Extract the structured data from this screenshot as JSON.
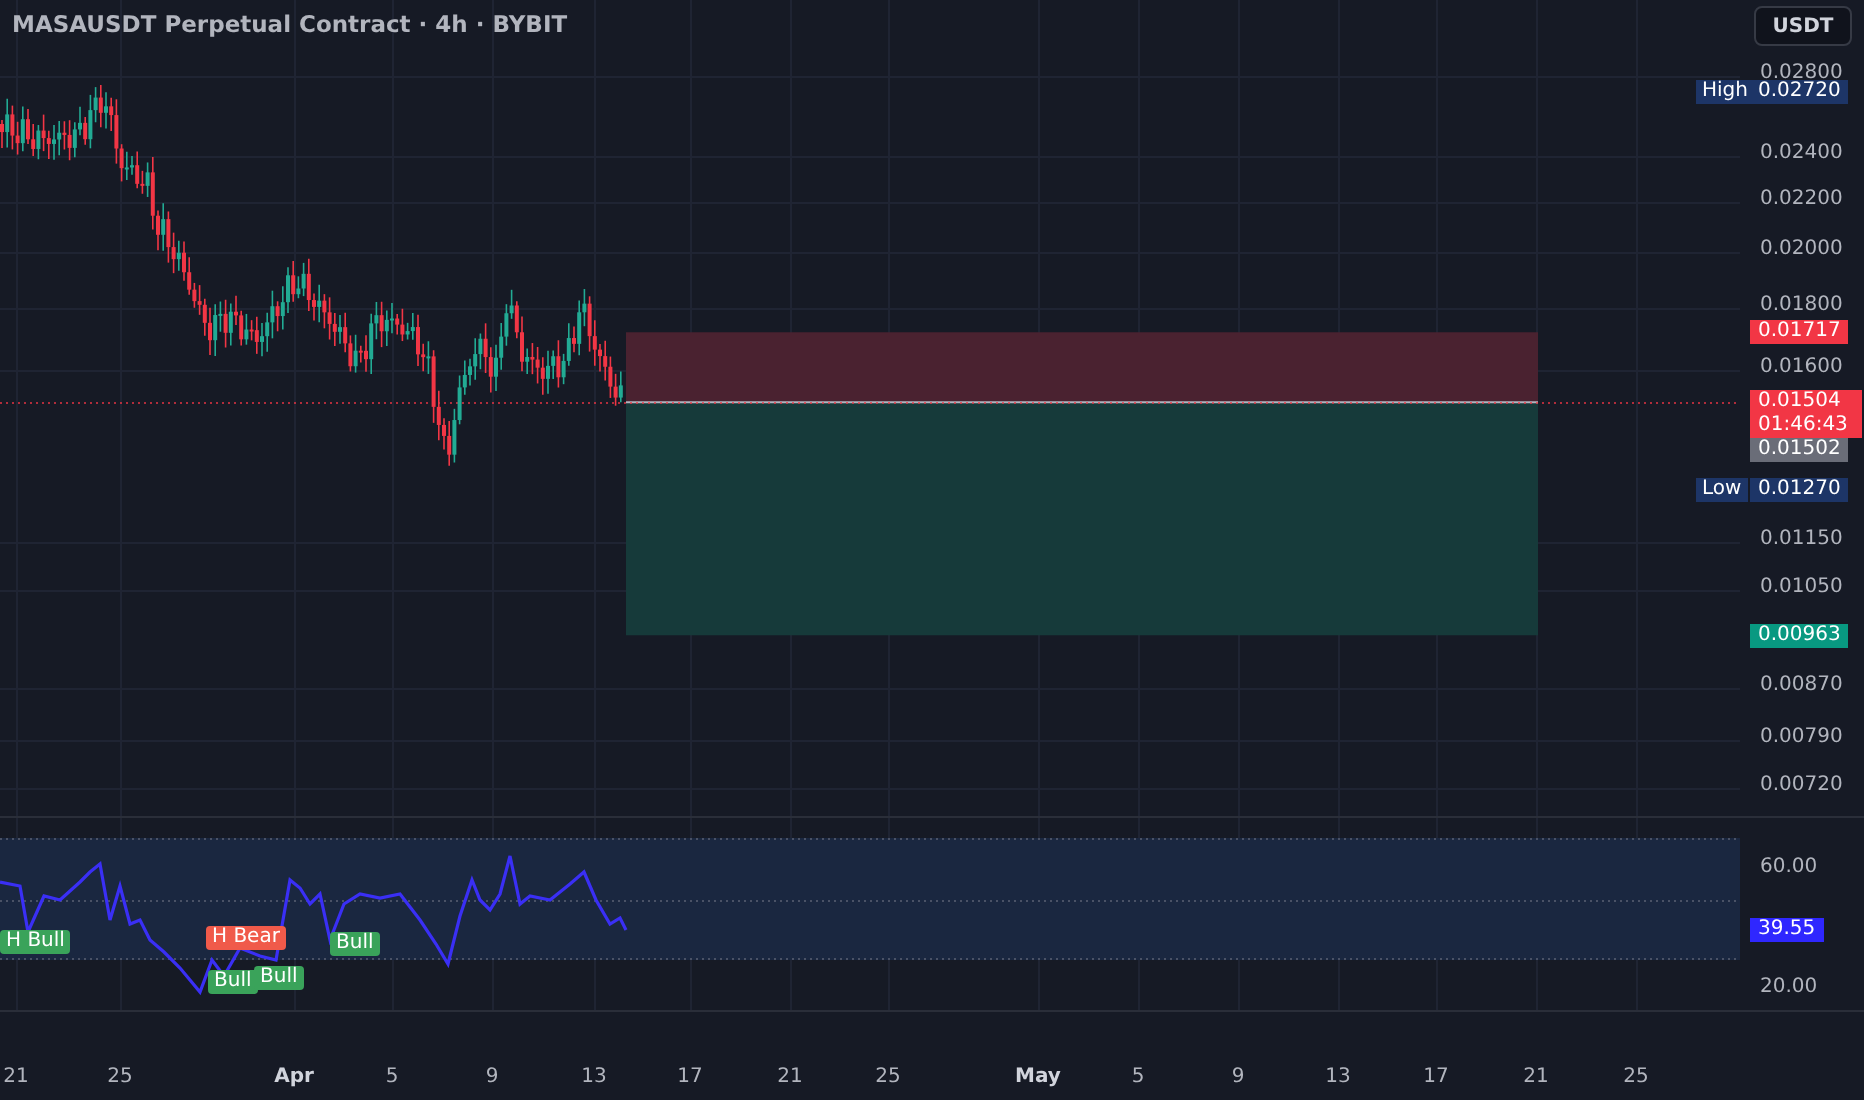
{
  "header": {
    "title": "MASAUSDT Perpetual Contract · 4h · BYBIT",
    "currency": "USDT"
  },
  "price_axis": {
    "ticks": [
      "0.02800",
      "0.02400",
      "0.02200",
      "0.02000",
      "0.01800",
      "0.01600",
      "0.01150",
      "0.01050",
      "0.00870",
      "0.00790",
      "0.00720"
    ],
    "markers": [
      {
        "kind": "high",
        "label": "High",
        "value": "0.02720"
      },
      {
        "kind": "stop",
        "value": "0.01717"
      },
      {
        "kind": "last",
        "value": "0.01504",
        "countdown": "01:46:43"
      },
      {
        "kind": "entry",
        "value": "0.01502"
      },
      {
        "kind": "low",
        "label": "Low",
        "value": "0.01270"
      },
      {
        "kind": "target",
        "value": "0.00963"
      }
    ]
  },
  "oscillator": {
    "ticks": [
      "60.00",
      "20.00"
    ],
    "value": "39.55",
    "signals": [
      {
        "kind": "bull",
        "label": "H Bull"
      },
      {
        "kind": "bear",
        "label": "H Bear"
      },
      {
        "kind": "bull",
        "label": "Bull"
      },
      {
        "kind": "bull",
        "label": "Bull"
      },
      {
        "kind": "bull",
        "label": "Bull"
      }
    ]
  },
  "time_axis": {
    "labels": [
      {
        "kind": "day",
        "text": "21"
      },
      {
        "kind": "day",
        "text": "25"
      },
      {
        "kind": "month",
        "text": "Apr"
      },
      {
        "kind": "day",
        "text": "5"
      },
      {
        "kind": "day",
        "text": "9"
      },
      {
        "kind": "day",
        "text": "13"
      },
      {
        "kind": "day",
        "text": "17"
      },
      {
        "kind": "day",
        "text": "21"
      },
      {
        "kind": "day",
        "text": "25"
      },
      {
        "kind": "month",
        "text": "May"
      },
      {
        "kind": "day",
        "text": "5"
      },
      {
        "kind": "day",
        "text": "9"
      },
      {
        "kind": "day",
        "text": "13"
      },
      {
        "kind": "day",
        "text": "17"
      },
      {
        "kind": "day",
        "text": "21"
      },
      {
        "kind": "day",
        "text": "25"
      }
    ]
  }
}
